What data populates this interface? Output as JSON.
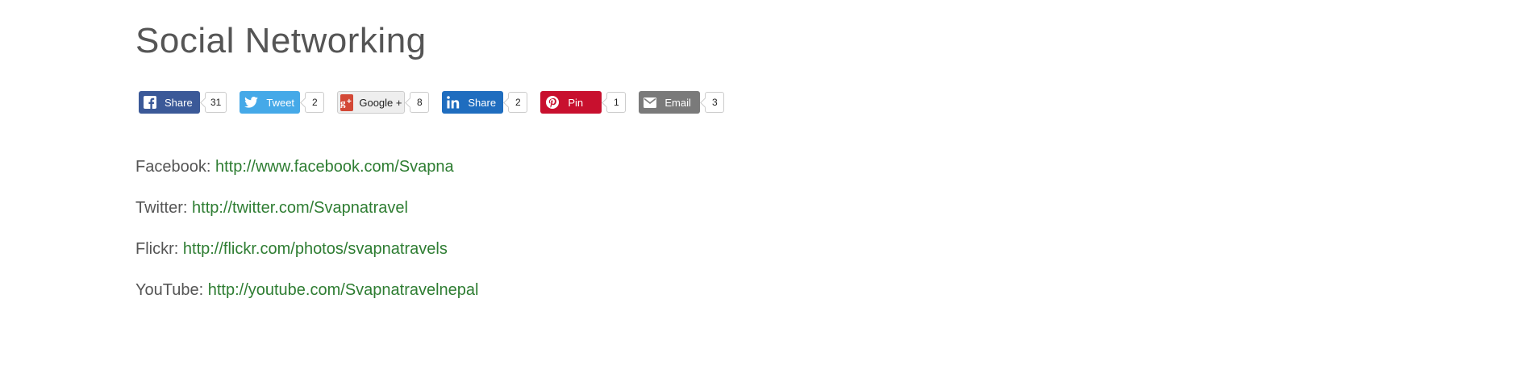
{
  "page": {
    "title": "Social Networking"
  },
  "share_buttons": [
    {
      "label": "Share",
      "count": "31",
      "icon": "facebook-icon",
      "color": "#3b5998"
    },
    {
      "label": "Tweet",
      "count": "2",
      "icon": "twitter-icon",
      "color": "#45a9e8"
    },
    {
      "label": "Google +",
      "count": "8",
      "icon": "google-plus-icon",
      "color": "#d34836"
    },
    {
      "label": "Share",
      "count": "2",
      "icon": "linkedin-icon",
      "color": "#1f6dbf"
    },
    {
      "label": "Pin",
      "count": "1",
      "icon": "pinterest-icon",
      "color": "#c8102e"
    },
    {
      "label": "Email",
      "count": "3",
      "icon": "email-icon",
      "color": "#7a7a7a"
    }
  ],
  "links": [
    {
      "label": "Facebook:",
      "url": "http://www.facebook.com/Svapna"
    },
    {
      "label": "Twitter:",
      "url": "http://twitter.com/Svapnatravel"
    },
    {
      "label": "Flickr:",
      "url": "http://flickr.com/photos/svapnatravels"
    },
    {
      "label": "YouTube:",
      "url": "http://youtube.com/Svapnatravelnepal"
    }
  ],
  "colors": {
    "title": "#555555",
    "link": "#2e7d32"
  }
}
